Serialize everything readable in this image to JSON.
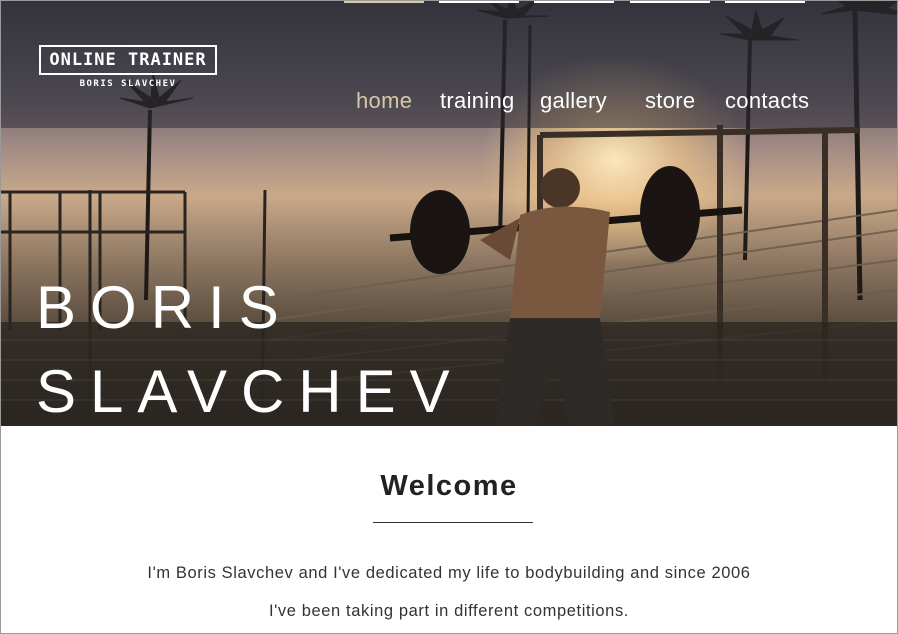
{
  "brand": {
    "title": "ONLINE TRAINER",
    "subtitle": "BORIS SLAVCHEV"
  },
  "nav": {
    "items": [
      {
        "label": "home",
        "active": true
      },
      {
        "label": "training",
        "active": false
      },
      {
        "label": "gallery",
        "active": false
      },
      {
        "label": "store",
        "active": false
      },
      {
        "label": "contacts",
        "active": false
      }
    ]
  },
  "hero": {
    "title_line1": "BORIS",
    "title_line2": "SLAVCHEV"
  },
  "welcome": {
    "heading": "Welcome",
    "line1": "I'm Boris Slavchev and I've dedicated my life to bodybuilding and since 2006",
    "line2": "I've been taking part in different competitions."
  },
  "colors": {
    "accent": "#d9c7a6",
    "text": "#333333",
    "header_overlay": "#2d2b34"
  }
}
